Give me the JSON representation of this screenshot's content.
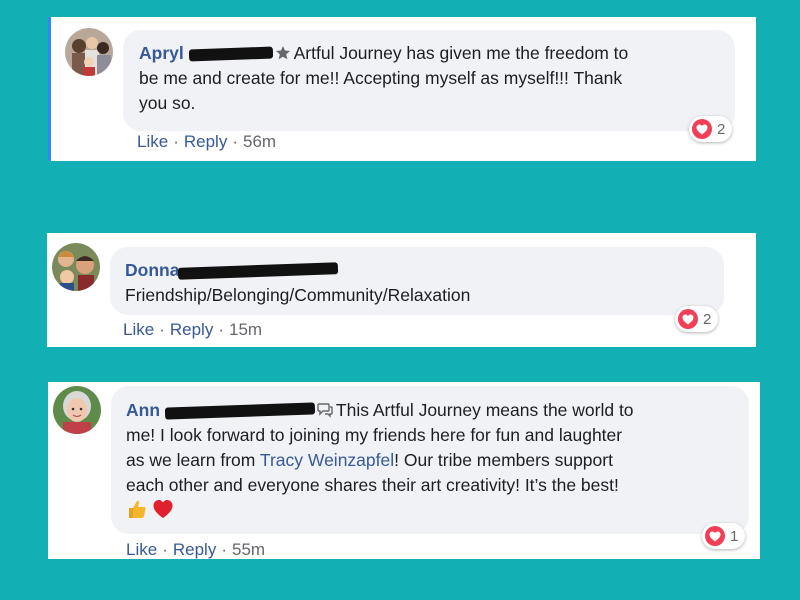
{
  "colors": {
    "background": "#12b0b4",
    "author": "#385898",
    "bubble": "#f0f2f5",
    "love": "#f33e58"
  },
  "comments": [
    {
      "author_visible": "Apryl",
      "author_badge_icon": "star-badge-icon",
      "text_lines": [
        "Artful Journey has given me the freedom to",
        "be me and create for me!! Accepting myself as myself!!! Thank",
        "you so."
      ],
      "like_label": "Like",
      "reply_label": "Reply",
      "time": "56m",
      "reaction_icon": "love-icon",
      "reaction_count": "2"
    },
    {
      "author_visible": "Donna",
      "text_lines": [
        "Friendship/Belonging/Community/Relaxation"
      ],
      "like_label": "Like",
      "reply_label": "Reply",
      "time": "15m",
      "reaction_icon": "love-icon",
      "reaction_count": "2"
    },
    {
      "author_visible": "Ann",
      "author_badge_icon": "conversation-starter-icon",
      "text_line1": "This Artful Journey means the world to",
      "text_line2": "me! I look forward to joining my friends here for fun and laughter",
      "text_line3_before": "as we learn from ",
      "mention": "Tracy Weinzapfel",
      "text_line3_after": "! Our tribe members support",
      "text_line4": "each other and everyone shares their art creativity! It’s the best!",
      "emojis": [
        "thumbs-up-icon",
        "red-heart-icon"
      ],
      "like_label": "Like",
      "reply_label": "Reply",
      "time": "55m",
      "reaction_icon": "love-icon",
      "reaction_count": "1"
    }
  ]
}
